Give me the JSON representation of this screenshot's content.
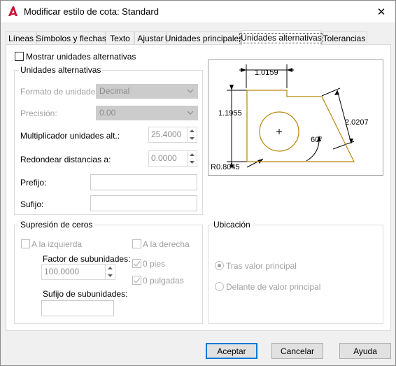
{
  "window": {
    "title": "Modificar estilo de cota: Standard",
    "close_glyph": "✕"
  },
  "tabs": [
    {
      "label": "Líneas",
      "active": false
    },
    {
      "label": "Símbolos y flechas",
      "active": false
    },
    {
      "label": "Texto",
      "active": false
    },
    {
      "label": "Ajustar",
      "active": false
    },
    {
      "label": "Unidades principales",
      "active": false
    },
    {
      "label": "Unidades alternativas",
      "active": true
    },
    {
      "label": "Tolerancias",
      "active": false
    }
  ],
  "show_alt_units": {
    "label": "Mostrar unidades alternativas",
    "checked": false
  },
  "alt_units_group": {
    "title": "Unidades alternativas",
    "format_label": "Formato de unidades:",
    "format_value": "Decimal",
    "precision_label": "Precisión:",
    "precision_value": "0.00",
    "multiplier_label": "Multiplicador unidades alt.:",
    "multiplier_value": "25.4000",
    "round_label": "Redondear distancias a:",
    "round_value": "0.0000",
    "prefix_label": "Prefijo:",
    "prefix_value": "",
    "suffix_label": "Sufijo:",
    "suffix_value": ""
  },
  "zero_suppression": {
    "title": "Supresión de ceros",
    "leading_label": "A la izquierda",
    "leading_checked": false,
    "trailing_label": "A la derecha",
    "trailing_checked": false,
    "subunit_factor_label": "Factor de subunidades:",
    "subunit_factor_value": "100.0000",
    "feet_label": "0 pies",
    "feet_checked": true,
    "inches_label": "0 pulgadas",
    "inches_checked": true,
    "subunit_suffix_label": "Sufijo de subunidades:",
    "subunit_suffix_value": ""
  },
  "placement": {
    "title": "Ubicación",
    "after_label": "Tras valor principal",
    "after_selected": true,
    "below_label": "Delante de valor principal",
    "below_selected": false
  },
  "preview": {
    "dim_top": "1.0159",
    "dim_left": "1.1955",
    "dim_right": "2.0207",
    "angle": "60°",
    "radius": "R0.8045",
    "shape_color": "#b8860b"
  },
  "buttons": {
    "ok": "Aceptar",
    "cancel": "Cancelar",
    "help": "Ayuda"
  },
  "colors": {
    "accent": "#0078d7",
    "app_icon": "#c8102e"
  }
}
